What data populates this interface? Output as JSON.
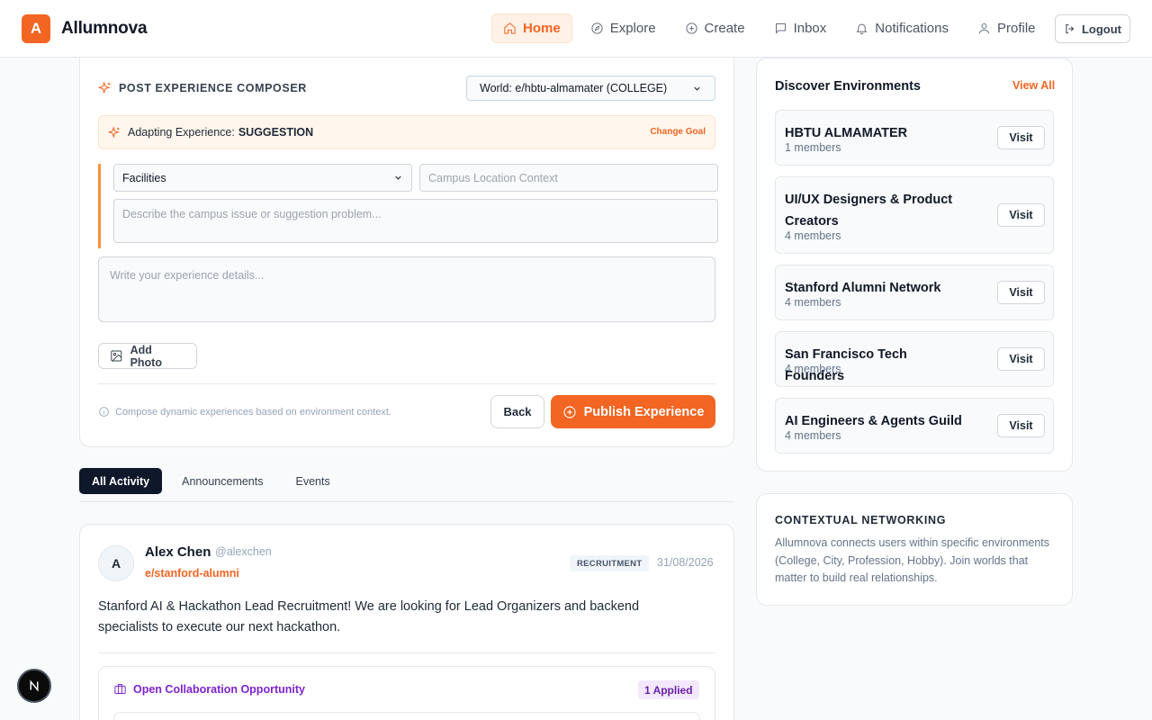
{
  "brand": {
    "logo_letter": "A",
    "name": "Allumnova",
    "accent_color": "#f26522"
  },
  "nav": {
    "items": [
      {
        "label": "Home",
        "icon": "home-icon",
        "active": true
      },
      {
        "label": "Explore",
        "icon": "compass-icon",
        "active": false
      },
      {
        "label": "Create",
        "icon": "plus-circle-icon",
        "active": false
      },
      {
        "label": "Inbox",
        "icon": "message-icon",
        "active": false
      },
      {
        "label": "Notifications",
        "icon": "bell-icon",
        "active": false
      },
      {
        "label": "Profile",
        "icon": "user-icon",
        "active": false
      }
    ],
    "logout_label": "Logout"
  },
  "composer": {
    "heading": "POST EXPERIENCE COMPOSER",
    "world_select": "World: e/hbtu-almamater (COLLEGE)",
    "adapting_label": "Adapting Experience:",
    "adapting_value": "SUGGESTION",
    "change_goal": "Change Goal",
    "category_select": "Facilities",
    "location_placeholder": "Campus Location Context",
    "issue_placeholder": "Describe the campus issue or suggestion problem...",
    "details_placeholder": "Write your experience details...",
    "add_photo": "Add Photo",
    "hint": "Compose dynamic experiences based on environment context.",
    "back": "Back",
    "publish": "Publish Experience"
  },
  "tabs": [
    {
      "label": "All Activity",
      "active": true
    },
    {
      "label": "Announcements",
      "active": false
    },
    {
      "label": "Events",
      "active": false
    }
  ],
  "post": {
    "avatar_letter": "A",
    "author": "Alex Chen",
    "handle": "@alexchen",
    "environment": "e/stanford-alumni",
    "badge": "RECRUITMENT",
    "date": "31/08/2026",
    "body": "Stanford AI & Hackathon Lead Recruitment! We are looking for Lead Organizers and backend specialists to execute our next hackathon.",
    "collab_title": "Open Collaboration Opportunity",
    "applied": "1 Applied"
  },
  "discover": {
    "title": "Discover Environments",
    "view_all": "View All",
    "visit_label": "Visit",
    "environments": [
      {
        "name": "HBTU ALMAMATER",
        "members": "1 members"
      },
      {
        "name": "UI/UX Designers & Product Creators",
        "members": "4 members"
      },
      {
        "name": "Stanford Alumni Network",
        "members": "4 members"
      },
      {
        "name": "San Francisco Tech Founders",
        "members": "4 members"
      },
      {
        "name": "AI Engineers & Agents Guild",
        "members": "4 members"
      }
    ]
  },
  "networking": {
    "title": "CONTEXTUAL NETWORKING",
    "text": "Allumnova connects users within specific environments (College, City, Profession, Hobby). Join worlds that matter to build real relationships."
  },
  "dev_badge": {
    "letter": "N"
  }
}
